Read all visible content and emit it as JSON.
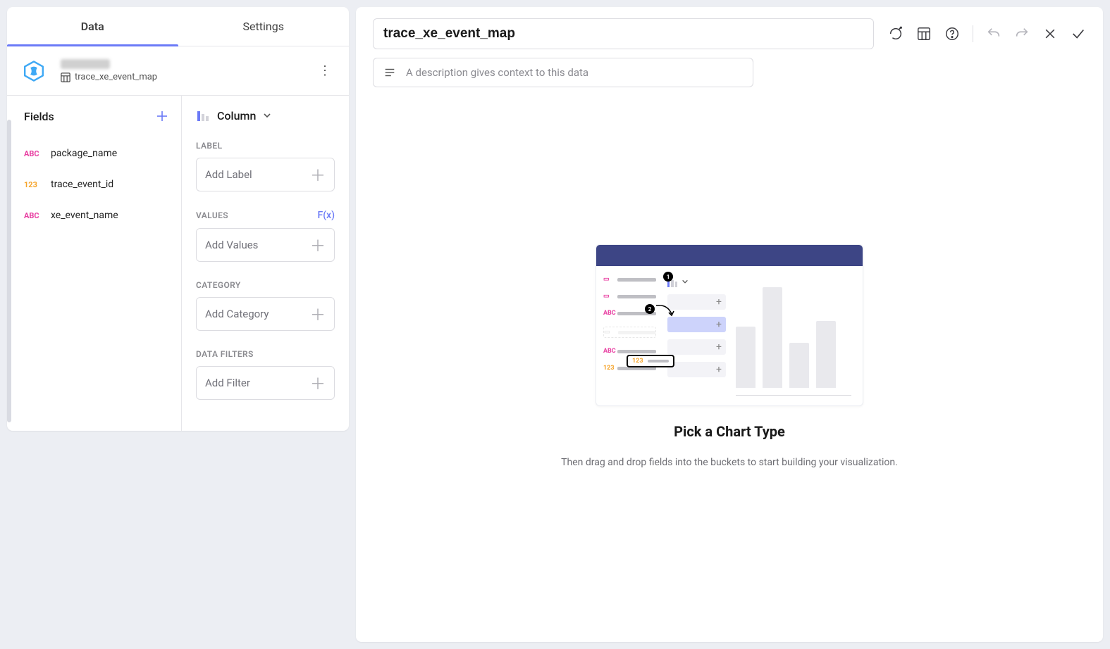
{
  "tabs": {
    "data": "Data",
    "settings": "Settings"
  },
  "source": {
    "table": "trace_xe_event_map"
  },
  "fields": {
    "header": "Fields",
    "items": [
      {
        "type": "ABC",
        "name": "package_name"
      },
      {
        "type": "123",
        "name": "trace_event_id"
      },
      {
        "type": "ABC",
        "name": "xe_event_name"
      }
    ]
  },
  "config": {
    "chart_type": "Column",
    "sections": {
      "label": {
        "title": "LABEL",
        "placeholder": "Add Label"
      },
      "values": {
        "title": "VALUES",
        "placeholder": "Add Values",
        "fx": "F(x)"
      },
      "category": {
        "title": "CATEGORY",
        "placeholder": "Add Category"
      },
      "data_filters": {
        "title": "DATA FILTERS",
        "placeholder": "Add Filter"
      }
    }
  },
  "editor": {
    "title": "trace_xe_event_map",
    "description_placeholder": "A description gives context to this data"
  },
  "empty_state": {
    "heading": "Pick a Chart Type",
    "sub": "Then drag and drop fields into the buckets to start building your visualization."
  }
}
